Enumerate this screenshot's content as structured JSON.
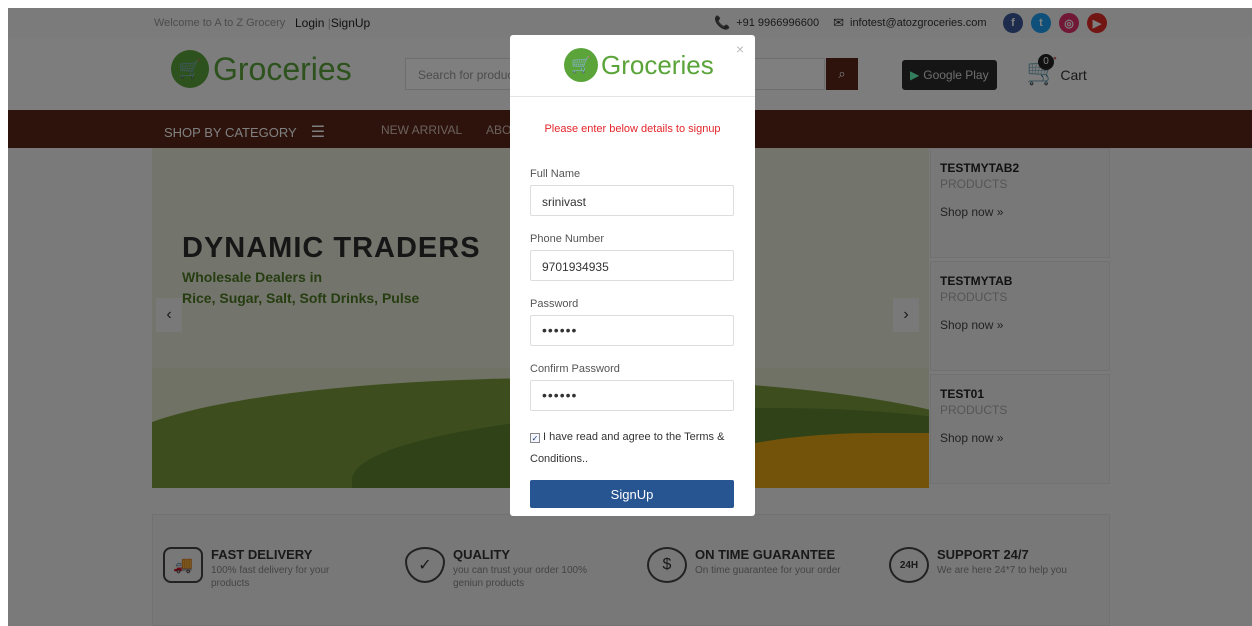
{
  "topbar": {
    "welcome": "Welcome to A to Z Grocery",
    "login": "Login",
    "signup": "SignUp",
    "phone": "+91 9966996600",
    "email": "infotest@atozgroceries.com",
    "social": [
      {
        "name": "facebook-icon",
        "glyph": "f",
        "color": "#3b5998"
      },
      {
        "name": "twitter-icon",
        "glyph": "t",
        "color": "#1da1f2"
      },
      {
        "name": "instagram-icon",
        "glyph": "◎",
        "color": "#e1306c"
      },
      {
        "name": "youtube-icon",
        "glyph": "▶",
        "color": "#e52d27"
      }
    ]
  },
  "header": {
    "logo": "Groceries",
    "search_placeholder": "Search for products",
    "google_play": "Google Play",
    "cart_count": "0",
    "cart_label": "Cart"
  },
  "nav": {
    "category": "SHOP BY CATEGORY",
    "links": [
      "NEW ARRIVAL",
      "ABOUT"
    ]
  },
  "banner": {
    "title": "DYNAMIC TRADERS",
    "subtitle1": "Wholesale Dealers in",
    "subtitle2": "Rice, Sugar, Salt, Soft Drinks, Pulse"
  },
  "side_cards": [
    {
      "title": "TESTMYTAB2",
      "sub": "PRODUCTS",
      "cta": "Shop now »"
    },
    {
      "title": "TESTMYTAB",
      "sub": "PRODUCTS",
      "cta": "Shop now »"
    },
    {
      "title": "TEST01",
      "sub": "PRODUCTS",
      "cta": "Shop now »"
    }
  ],
  "features": [
    {
      "title": "FAST DELIVERY",
      "desc": "100% fast delivery for your products"
    },
    {
      "title": "QUALITY",
      "desc": "you can trust your order 100% geniun products"
    },
    {
      "title": "ON TIME GUARANTEE",
      "desc": "On time guarantee for your order"
    },
    {
      "title": "SUPPORT 24/7",
      "desc": "We are here 24*7 to help you"
    }
  ],
  "modal": {
    "logo": "Groceries",
    "close": "×",
    "notice": "Please enter below details to signup",
    "full_name_label": "Full Name",
    "full_name_value": "srinivast",
    "phone_label": "Phone Number",
    "phone_value": "9701934935",
    "password_label": "Password",
    "password_value": "••••••",
    "confirm_label": "Confirm Password",
    "confirm_value": "••••••",
    "agree_text": "I have read and agree to the Terms & Conditions..",
    "submit": "SignUp"
  }
}
